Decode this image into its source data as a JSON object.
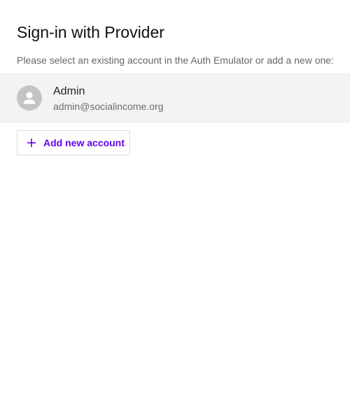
{
  "page": {
    "title": "Sign-in with Provider",
    "subtitle": "Please select an existing account in the Auth Emulator or add a new one:"
  },
  "accounts": [
    {
      "name": "Admin",
      "email": "admin@socialincome.org",
      "icon": "person-icon"
    }
  ],
  "actions": {
    "add_account_label": "Add new account",
    "add_account_icon": "plus-icon"
  },
  "colors": {
    "accent": "#6200ee",
    "selected_row_background": "#f3f3f3",
    "avatar_background": "#c4c4c4"
  }
}
